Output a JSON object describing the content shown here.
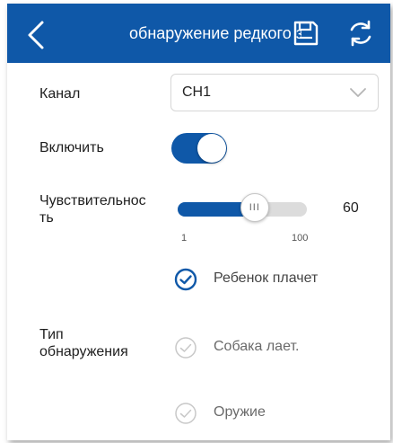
{
  "colors": {
    "accent": "#0f58a8",
    "text": "#1e1e1e",
    "muted": "#aaaaaa",
    "track": "#dcdcdc"
  },
  "header": {
    "title": "обнаружение редкого звука",
    "back_icon": "chevron-left-icon",
    "save_icon": "save-icon",
    "refresh_icon": "refresh-icon"
  },
  "form": {
    "channel": {
      "label": "Канал",
      "value": "CH1",
      "icon": "chevron-down-icon"
    },
    "enable": {
      "label": "Включить",
      "on": true
    },
    "sensitivity": {
      "label_line1": "Чувствительнос",
      "label_line2": "ть",
      "value": "60",
      "min": "1",
      "max": "100"
    },
    "detection_type": {
      "label_line1": "Тип",
      "label_line2": "обнаружения",
      "options": [
        {
          "label": "Ребенок плачет",
          "checked": true
        },
        {
          "label": "Собака лает.",
          "checked": false
        },
        {
          "label": "Оружие",
          "checked": false
        }
      ]
    }
  }
}
